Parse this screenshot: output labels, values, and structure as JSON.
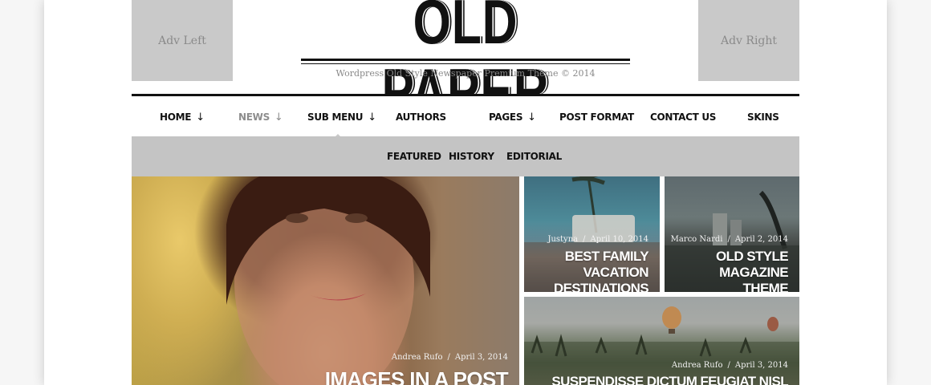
{
  "ads": {
    "left": "Adv Left",
    "right": "Adv Right"
  },
  "brand": {
    "title": "OLD PAPER",
    "tagline": "Wordpress Old Style Newspaper Premium Theme © 2014"
  },
  "nav": {
    "items": [
      {
        "label": "HOME",
        "arrow": "↓"
      },
      {
        "label": "NEWS",
        "arrow": "↓"
      },
      {
        "label": "SUB MENU",
        "arrow": "↓"
      },
      {
        "label": "AUTHORS",
        "arrow": ""
      },
      {
        "label": "PAGES",
        "arrow": "↓"
      },
      {
        "label": "POST FORMAT",
        "arrow": ""
      },
      {
        "label": "CONTACT US",
        "arrow": ""
      },
      {
        "label": "SKINS",
        "arrow": ""
      }
    ],
    "active": "NEWS"
  },
  "subnav": {
    "items": [
      "FEATURED",
      "HISTORY",
      "EDITORIAL"
    ]
  },
  "posts": [
    {
      "author": "Andrea Rufo",
      "date": "April 3, 2014",
      "title": "IMAGES IN A POST"
    },
    {
      "author": "Justyna",
      "date": "April 10, 2014",
      "title_line1": "BEST FAMILY VACATION",
      "title_line2": "DESTINATIONS"
    },
    {
      "author": "Marco Nardi",
      "date": "April 2, 2014",
      "title_line1": "OLD STYLE MAGAZINE",
      "title_line2": "THEME"
    },
    {
      "author": "Andrea Rufo",
      "date": "April 3, 2014",
      "title": "SUSPENDISSE DICTUM FEUGIAT NISL"
    }
  ],
  "meta_separator": "/",
  "colors": {
    "ad_bg": "#c9c9c9",
    "subnav_bg": "#c4c4c4",
    "active_nav": "#8d8d8d",
    "text": "#111111"
  }
}
